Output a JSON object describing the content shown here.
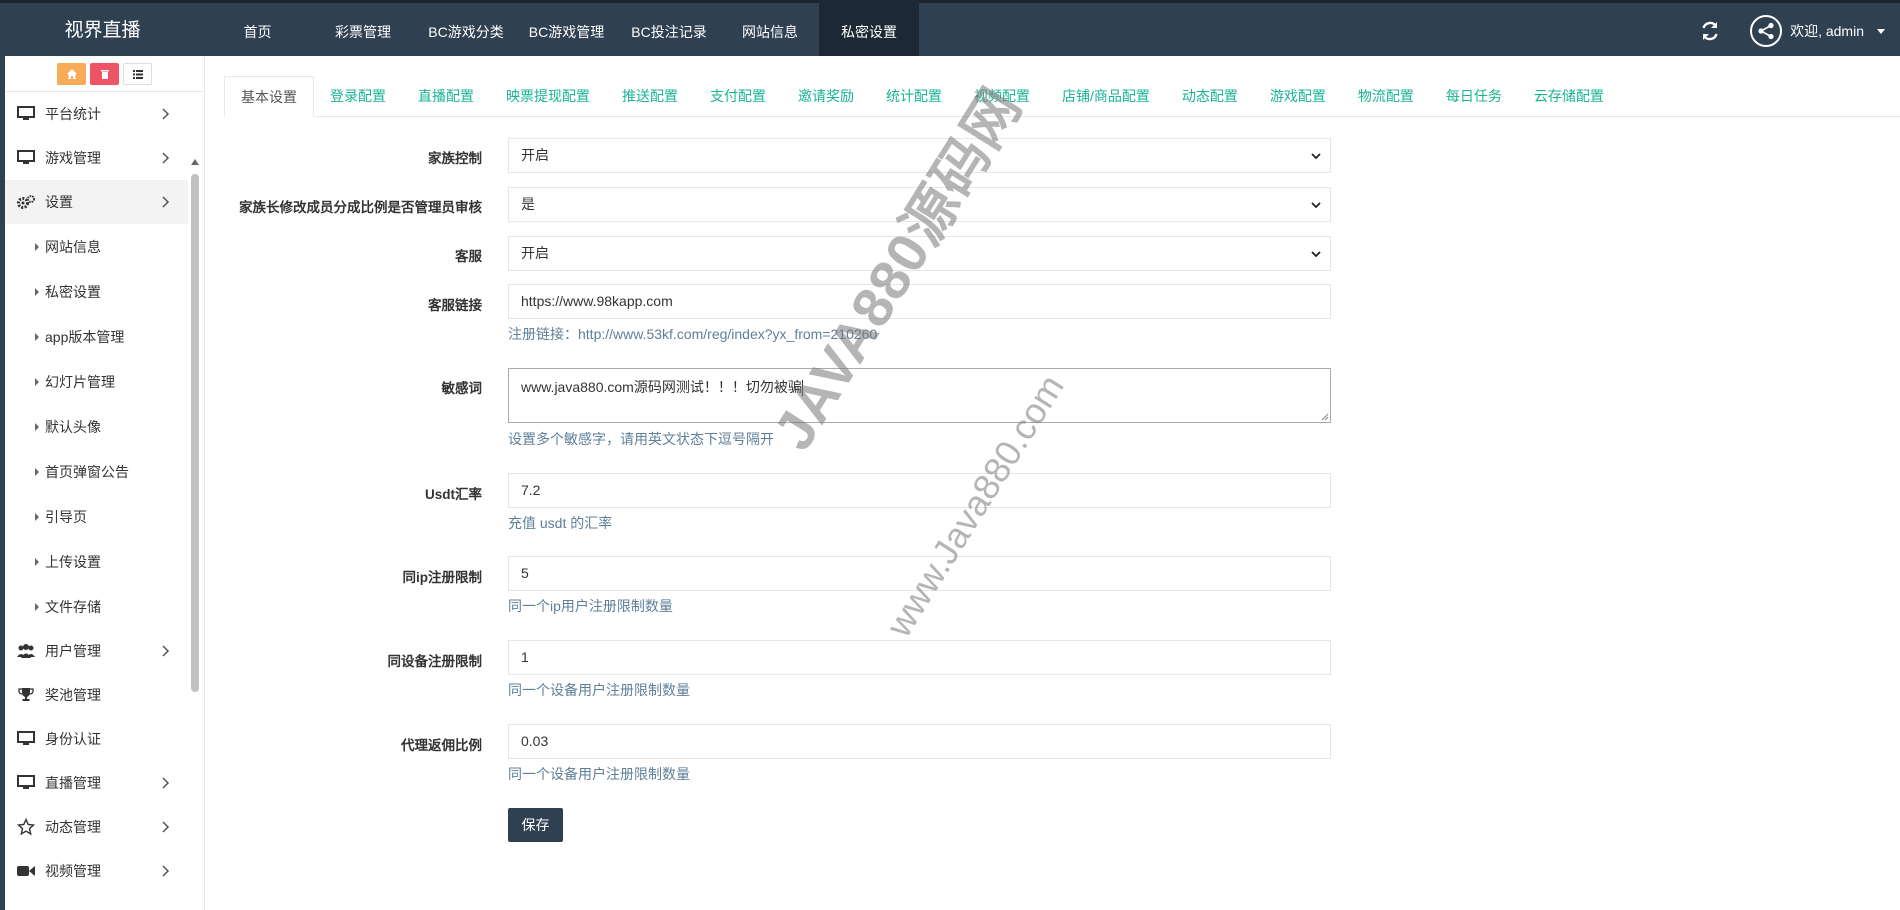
{
  "brand": "视界直播",
  "nav": [
    {
      "label": "首页",
      "width": 105
    },
    {
      "label": "彩票管理",
      "width": 106
    },
    {
      "label": "BC游戏分类",
      "width": 100
    },
    {
      "label": "BC游戏管理",
      "width": 101
    },
    {
      "label": "BC投注记录",
      "width": 104
    },
    {
      "label": "网站信息",
      "width": 98
    },
    {
      "label": "私密设置",
      "width": 100
    }
  ],
  "header": {
    "welcome": "欢迎, admin"
  },
  "sidebar": {
    "items": [
      {
        "label": "平台统计"
      },
      {
        "label": "游戏管理"
      },
      {
        "label": "设置"
      },
      {
        "label": "用户管理"
      },
      {
        "label": "奖池管理"
      },
      {
        "label": "身份认证"
      },
      {
        "label": "直播管理"
      },
      {
        "label": "动态管理"
      },
      {
        "label": "视频管理"
      }
    ],
    "sub_items": [
      "网站信息",
      "私密设置",
      "app版本管理",
      "幻灯片管理",
      "默认头像",
      "首页弹窗公告",
      "引导页",
      "上传设置",
      "文件存储"
    ]
  },
  "tabs": [
    "基本设置",
    "登录配置",
    "直播配置",
    "映票提现配置",
    "推送配置",
    "支付配置",
    "邀请奖励",
    "统计配置",
    "视频配置",
    "店铺/商品配置",
    "动态配置",
    "游戏配置",
    "物流配置",
    "每日任务",
    "云存储配置"
  ],
  "form": {
    "family_control": {
      "label": "家族控制",
      "value": "开启"
    },
    "family_review": {
      "label": "家族长修改成员分成比例是否管理员审核",
      "value": "是"
    },
    "customer_service": {
      "label": "客服",
      "value": "开启"
    },
    "cs_link": {
      "label": "客服链接",
      "value": "https://www.98kapp.com",
      "hint": "注册链接：http://www.53kf.com/reg/index?yx_from=210260"
    },
    "sensitive": {
      "label": "敏感词",
      "value": "www.java880.com源码网测试！！！切勿被骗",
      "hint": "设置多个敏感字，请用英文状态下逗号隔开"
    },
    "usdt": {
      "label": "Usdt汇率",
      "value": "7.2",
      "hint": "充值 usdt 的汇率"
    },
    "ip_limit": {
      "label": "同ip注册限制",
      "value": "5",
      "hint": "同一个ip用户注册限制数量"
    },
    "device_limit": {
      "label": "同设备注册限制",
      "value": "1",
      "hint": "同一个设备用户注册限制数量"
    },
    "agent_ratio": {
      "label": "代理返佣比例",
      "value": "0.03",
      "hint": "同一个设备用户注册限制数量"
    },
    "save": "保存"
  },
  "watermark": {
    "big": "JAVA880源码网",
    "small": "www.Java880.com"
  },
  "colors": {
    "topbar": "#2f4050",
    "accent": "#1ab394",
    "hint": "#5f7f99"
  }
}
